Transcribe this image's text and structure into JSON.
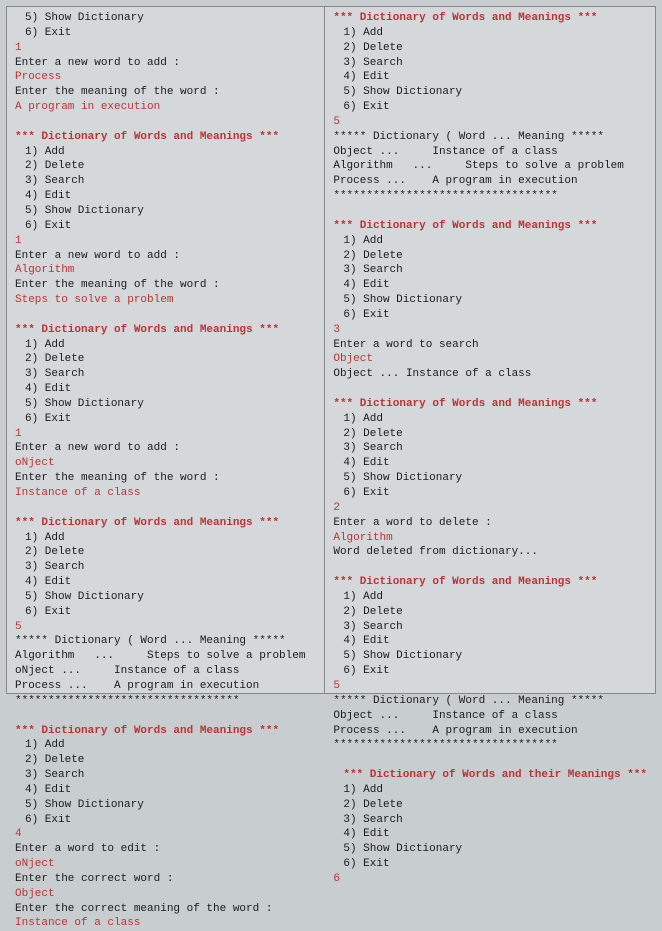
{
  "menu": {
    "header": "*** Dictionary of Words and Meanings ***",
    "header_their": "*** Dictionary of Words and their Meanings ***",
    "items": [
      "1) Add",
      "2) Delete",
      "3) Search",
      "4) Edit",
      "5) Show Dictionary",
      "6) Exit"
    ],
    "item5": "5) Show Dictionary",
    "item6": "6) Exit"
  },
  "prompts": {
    "add_word": "Enter a new word to add :",
    "meaning": "Enter the meaning of the word :",
    "search": "Enter a word to search",
    "delete": "Enter a word to delete :",
    "edit": "Enter a word to edit :",
    "correct_word": "Enter the correct word :",
    "correct_meaning": "Enter the correct meaning of the word :"
  },
  "inputs": {
    "process": "Process",
    "process_mean": "A program in execution",
    "algorithm": "Algorithm",
    "algorithm_mean": "Steps to solve a problem",
    "object_typo": "oNject",
    "object": "Object",
    "object_mean": "Instance of a class"
  },
  "choices": {
    "c1": "1",
    "c2": "2",
    "c3": "3",
    "c4": "4",
    "c5": "5",
    "c6": "6"
  },
  "display": {
    "header": "***** Dictionary ( Word ... Meaning *****",
    "alg_line": "Algorithm   ...     Steps to solve a problem",
    "obj_typo_line": "oNject ...     Instance of a class",
    "obj_line": "Object ...     Instance of a class",
    "proc_line": "Process ...    A program in execution",
    "stars": "**********************************",
    "search_result": "Object ... Instance of a class",
    "deleted": "Word deleted from dictionary..."
  }
}
